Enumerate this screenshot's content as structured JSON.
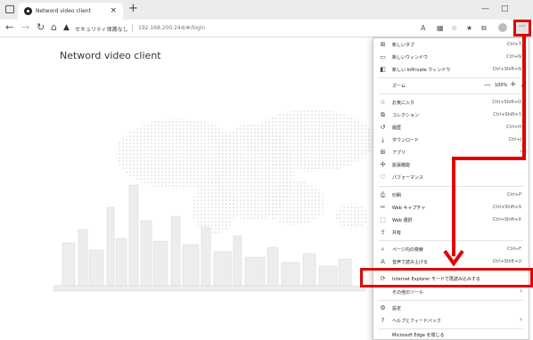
{
  "tab": {
    "title": "Netword video client"
  },
  "address": {
    "security_text": "セキュリティ保護なし",
    "url": "192.168.200.244/#/login"
  },
  "page": {
    "title": "Netword video client"
  },
  "menu": {
    "new_tab": {
      "label": "新しいタブ",
      "shortcut": "Ctrl+T"
    },
    "new_window": {
      "label": "新しいウィンドウ",
      "shortcut": "Ctrl+N"
    },
    "inprivate": {
      "label": "新しい InPrivate ウィンドウ",
      "shortcut": "Ctrl+Shift+N"
    },
    "zoom": {
      "label": "ズーム",
      "value": "100%"
    },
    "favorites": {
      "label": "お気に入り",
      "shortcut": "Ctrl+Shift+O"
    },
    "collections": {
      "label": "コレクション",
      "shortcut": "Ctrl+Shift+Y"
    },
    "history": {
      "label": "履歴",
      "shortcut": "Ctrl+H"
    },
    "downloads": {
      "label": "ダウンロード",
      "shortcut": "Ctrl+J"
    },
    "apps": {
      "label": "アプリ"
    },
    "extensions": {
      "label": "拡張機能"
    },
    "performance": {
      "label": "パフォーマンス"
    },
    "print": {
      "label": "印刷",
      "shortcut": "Ctrl+P"
    },
    "web_capture": {
      "label": "Web キャプチャ",
      "shortcut": "Ctrl+Shift+S"
    },
    "web_select": {
      "label": "Web 選択",
      "shortcut": "Ctrl+Shift+X"
    },
    "share": {
      "label": "共有"
    },
    "find": {
      "label": "ページ内の検索",
      "shortcut": "Ctrl+F"
    },
    "read_aloud": {
      "label": "音声で読み上げる",
      "shortcut": "Ctrl+Shift+U"
    },
    "ie_mode": {
      "label": "Internet Explorer モードで再読み込みする"
    },
    "more_tools": {
      "label": "その他のツール"
    },
    "settings": {
      "label": "設定"
    },
    "help": {
      "label": "ヘルプとフィードバック"
    },
    "close_edge": {
      "label": "Microsoft Edge を閉じる"
    }
  },
  "colors": {
    "annotation": "#e00000",
    "menu_bg": "#ffffff",
    "tabstrip_bg": "#ececec"
  }
}
